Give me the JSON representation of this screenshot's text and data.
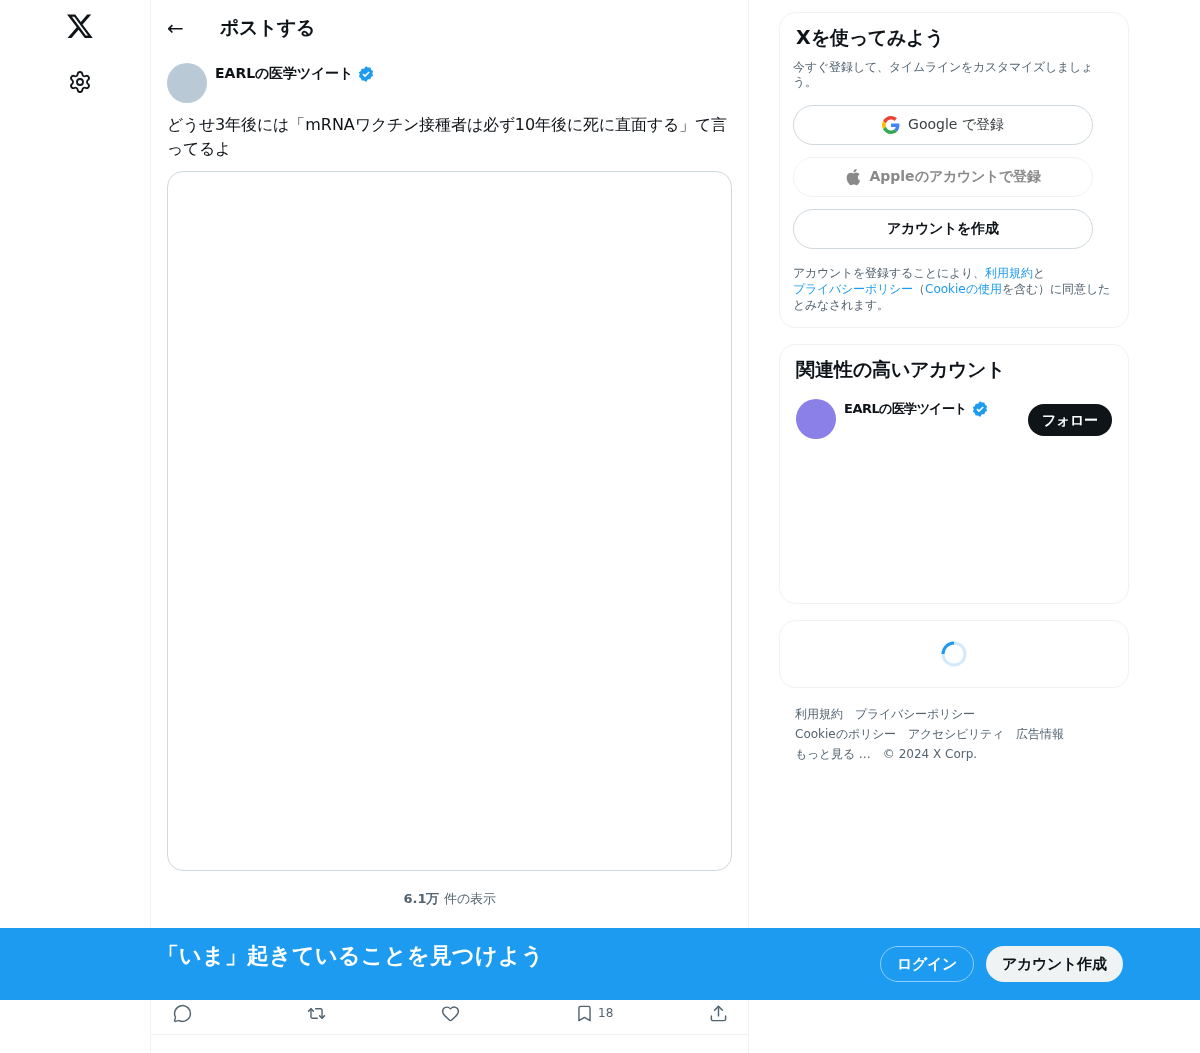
{
  "header": {
    "back": "←",
    "title": "ポストする"
  },
  "post": {
    "author": "EARLの医学ツイート",
    "verified": true,
    "text": "どうせ3年後には「mRNAワクチン接種者は必ず10年後に死に直面する」て言ってるよ",
    "views": "**6.1万** 件の表示",
    "actions": [
      {
        "kind": "reply"
      },
      {
        "kind": "repost"
      },
      {
        "kind": "like"
      },
      {
        "kind": "bookmark",
        "count": "18"
      },
      {
        "kind": "share"
      }
    ]
  },
  "signup": {
    "title": "Xを使ってみよう",
    "subtitle": "今すぐ登録して、タイムラインをカスタマイズしましょう。",
    "buttons": [
      {
        "kind": "google",
        "label": "Google で登録",
        "disabled": false
      },
      {
        "kind": "apple",
        "label": "Appleのアカウントで登録",
        "disabled": true
      },
      {
        "kind": "plain",
        "label": "アカウントを作成",
        "disabled": false
      }
    ],
    "terms": [
      {
        "kind": "text",
        "text": "アカウントを登録することにより、"
      },
      {
        "kind": "link",
        "text": "利用規約"
      },
      {
        "kind": "text",
        "text": "と"
      },
      {
        "kind": "link",
        "text": "プライバシーポリシー"
      },
      {
        "kind": "text",
        "text": "（"
      },
      {
        "kind": "link",
        "text": "Cookieの使用"
      },
      {
        "kind": "text",
        "text": "を含む）に同意したとみなされます。"
      }
    ]
  },
  "related": {
    "title": "関連性の高いアカウント",
    "accounts": [
      {
        "name": "EARLの医学ツイート",
        "verified": true,
        "button": "フォロー"
      }
    ]
  },
  "footer": {
    "links": [
      "利用規約",
      "プライバシーポリシー",
      "Cookieのポリシー",
      "アクセシビリティ",
      "広告情報",
      "もっと見る …"
    ],
    "copyright": "© 2024 X Corp."
  },
  "banner": {
    "text": "「いま」起きていることを見つけよう",
    "login": "ログイン",
    "signup": "アカウント作成"
  }
}
